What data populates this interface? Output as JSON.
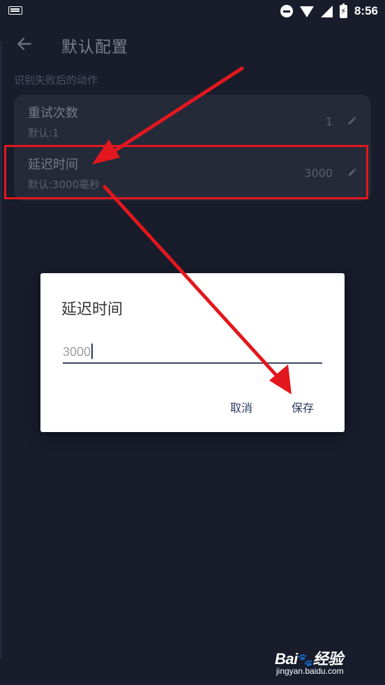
{
  "status_bar": {
    "time": "8:56"
  },
  "app_bar": {
    "title": "默认配置"
  },
  "section": {
    "label": "识别失败后的动作"
  },
  "settings": [
    {
      "title": "重试次数",
      "subtitle": "默认:1",
      "value": "1"
    },
    {
      "title": "延迟时间",
      "subtitle": "默认:3000毫秒",
      "value": "3000"
    }
  ],
  "dialog": {
    "title": "延迟时间",
    "input_value": "3000",
    "cancel_label": "取消",
    "save_label": "保存"
  },
  "watermark": {
    "logo": "Bai 经验",
    "logo_left": "Bai",
    "logo_right": "经验",
    "site": "jingyan.baidu.com"
  },
  "colors": {
    "annotation": "#e3171e",
    "background": "#181c2b"
  }
}
